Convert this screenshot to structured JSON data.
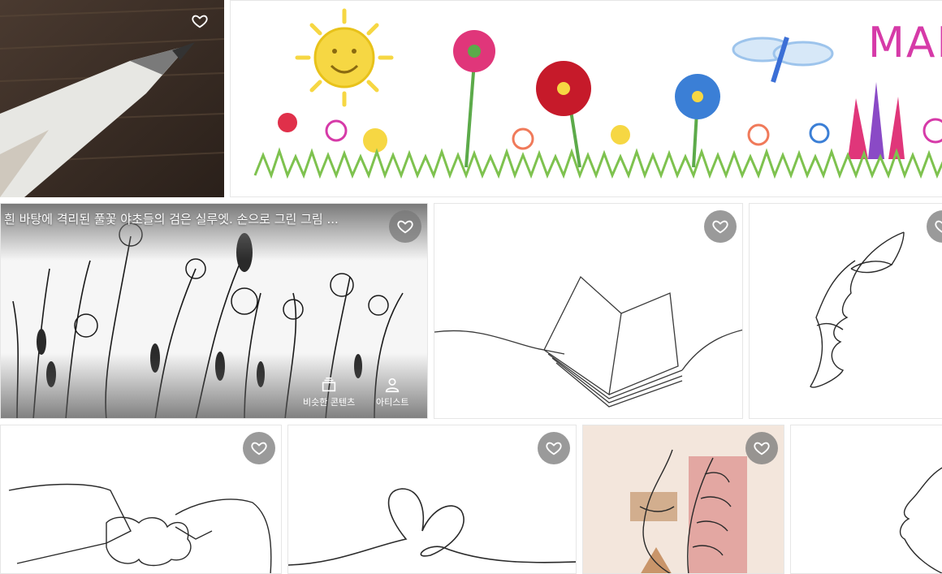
{
  "tiles": {
    "pencil": {
      "icon": "heart-outline-icon"
    },
    "kids_flowers": {
      "text": "MAN",
      "icon": "none"
    },
    "wildflowers": {
      "caption": "흰 바탕에 격리된 풀꽃 야초들의 검은 실루엣. 손으로 그린 그림 ...",
      "icon": "heart-outline-icon",
      "actions": [
        {
          "label": "비슷한 콘텐츠",
          "icon": "similar-content-icon"
        },
        {
          "label": "아티스트",
          "icon": "artist-icon"
        }
      ]
    },
    "book": {
      "icon": "heart-outline-icon"
    },
    "face": {
      "icon": "heart-outline-icon"
    },
    "puzzle": {
      "icon": "heart-outline-icon"
    },
    "hearts": {
      "icon": "heart-outline-icon"
    },
    "leaf_face": {
      "icon": "heart-outline-icon"
    }
  },
  "colors": {
    "fav_bg": "#7a7a7a",
    "accent_pink": "#d63aa8",
    "leaf_bg": "#f3e6dc",
    "leaf_rect": "#e3a7a2"
  }
}
